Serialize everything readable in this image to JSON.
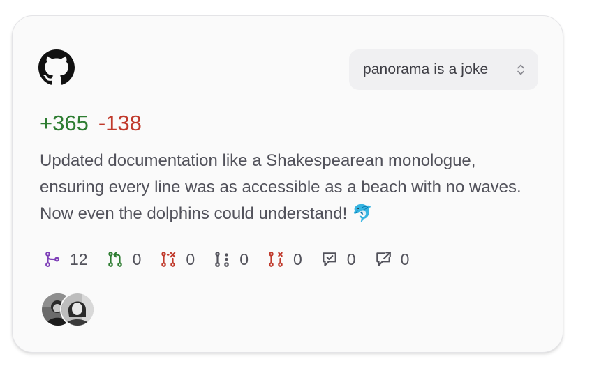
{
  "header": {
    "logo_icon": "github-icon",
    "repo_select": {
      "selected": "panorama is a joke",
      "icon": "chevron-up-down-icon"
    }
  },
  "diff": {
    "additions": "+365",
    "deletions": "-138",
    "add_color": "#2e7d32",
    "del_color": "#c0392b"
  },
  "description": "Updated documentation like a Shakespearean monologue, ensuring every line was as accessible as a beach with no waves. Now even the dolphins could understand! 🐬",
  "stats": [
    {
      "icon": "commit-branch-icon",
      "value": "12",
      "color": "#7e3fb8"
    },
    {
      "icon": "pull-request-open-icon",
      "value": "0",
      "color": "#2e7d32"
    },
    {
      "icon": "pull-request-closed-icon",
      "value": "0",
      "color": "#c0392b"
    },
    {
      "icon": "issue-draft-icon",
      "value": "0",
      "color": "#52525b"
    },
    {
      "icon": "issue-closed-icon",
      "value": "0",
      "color": "#c0392b"
    },
    {
      "icon": "review-comment-icon",
      "value": "0",
      "color": "#52525b"
    },
    {
      "icon": "comment-forward-icon",
      "value": "0",
      "color": "#52525b"
    }
  ],
  "contributors": [
    {
      "icon": "contributor-avatar"
    },
    {
      "icon": "contributor-avatar"
    }
  ]
}
